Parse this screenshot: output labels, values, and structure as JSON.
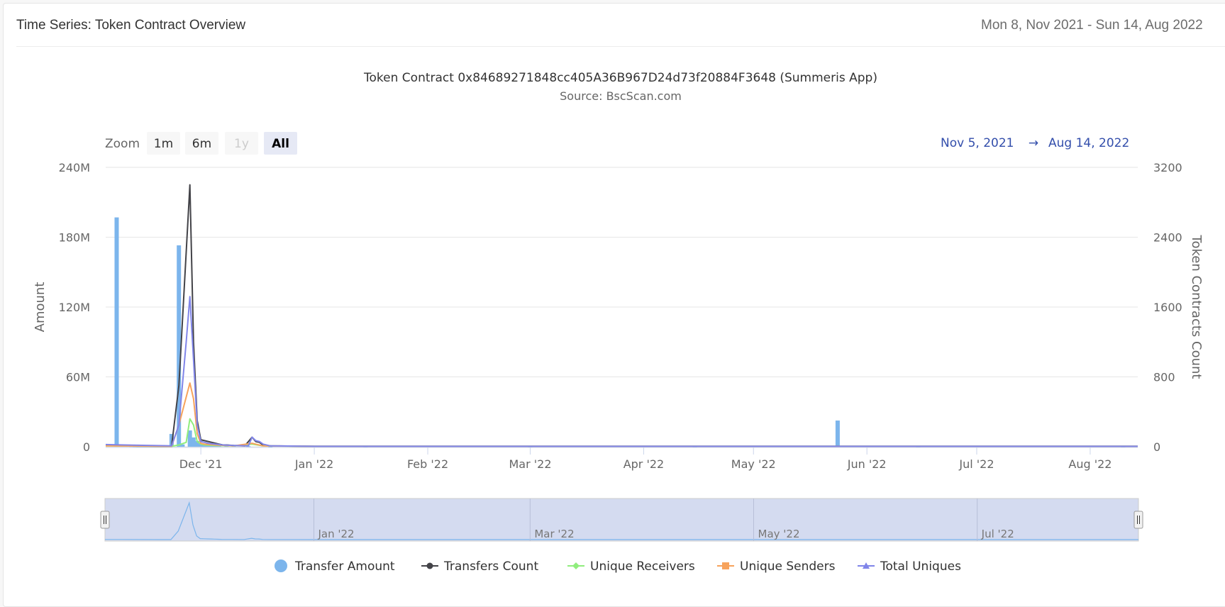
{
  "header": {
    "title": "Time Series: Token Contract Overview",
    "date_range": "Mon 8, Nov 2021 - Sun 14, Aug 2022"
  },
  "range_selector": {
    "zoom_label": "Zoom",
    "buttons": [
      {
        "label": "1m",
        "state": "normal"
      },
      {
        "label": "6m",
        "state": "normal"
      },
      {
        "label": "1y",
        "state": "disabled"
      },
      {
        "label": "All",
        "state": "active"
      }
    ],
    "from": "Nov 5, 2021",
    "arrow": "→",
    "to": "Aug 14, 2022"
  },
  "colors": {
    "transfer_amount": "#7cb5ec",
    "transfers_count": "#434348",
    "unique_receivers": "#90ed7d",
    "unique_senders": "#f7a35c",
    "total_uniques": "#8085e9",
    "navigator_mask": "#cfd7ee"
  },
  "chart_data": {
    "type": "line",
    "title": "Token Contract 0x84689271848cc405A36B967D24d73f20884F3648 (Summeris App)",
    "subtitle": "Source: BscScan.com",
    "x_type": "date",
    "x_range": [
      "2021-11-05",
      "2022-08-14"
    ],
    "x_ticks": [
      {
        "date": "2021-12-01",
        "label": "Dec '21"
      },
      {
        "date": "2022-01-01",
        "label": "Jan '22"
      },
      {
        "date": "2022-02-01",
        "label": "Feb '22"
      },
      {
        "date": "2022-03-01",
        "label": "Mar '22"
      },
      {
        "date": "2022-04-01",
        "label": "Apr '22"
      },
      {
        "date": "2022-05-01",
        "label": "May '22"
      },
      {
        "date": "2022-06-01",
        "label": "Jun '22"
      },
      {
        "date": "2022-07-01",
        "label": "Jul '22"
      },
      {
        "date": "2022-08-01",
        "label": "Aug '22"
      }
    ],
    "y_left": {
      "label": "Amount",
      "range": [
        0,
        240000000
      ],
      "ticks": [
        0,
        60000000,
        120000000,
        180000000,
        240000000
      ],
      "tick_labels": [
        "0",
        "60M",
        "120M",
        "180M",
        "240M"
      ]
    },
    "y_right": {
      "label": "Token Contracts Count",
      "range": [
        0,
        3200
      ],
      "ticks": [
        0,
        800,
        1600,
        2400,
        3200
      ],
      "tick_labels": [
        "0",
        "800",
        "1600",
        "2400",
        "3200"
      ]
    },
    "grid": true,
    "legend_position": "bottom",
    "series": [
      {
        "name": "Transfer Amount",
        "kind": "column",
        "axis": "left",
        "data": [
          [
            "2021-11-08",
            197000000
          ],
          [
            "2021-11-09",
            1000000
          ],
          [
            "2021-11-10",
            800000
          ],
          [
            "2021-11-11",
            600000
          ],
          [
            "2021-11-12",
            500000
          ],
          [
            "2021-11-13",
            400000
          ],
          [
            "2021-11-14",
            300000
          ],
          [
            "2021-11-15",
            300000
          ],
          [
            "2021-11-16",
            300000
          ],
          [
            "2021-11-17",
            300000
          ],
          [
            "2021-11-18",
            300000
          ],
          [
            "2021-11-19",
            300000
          ],
          [
            "2021-11-20",
            300000
          ],
          [
            "2021-11-21",
            300000
          ],
          [
            "2021-11-22",
            300000
          ],
          [
            "2021-11-23",
            11000000
          ],
          [
            "2021-11-25",
            173000000
          ],
          [
            "2021-11-26",
            2000000
          ],
          [
            "2021-11-28",
            14000000
          ],
          [
            "2021-11-29",
            8000000
          ],
          [
            "2021-11-30",
            5000000
          ],
          [
            "2021-12-01",
            3000000
          ],
          [
            "2021-12-02",
            2000000
          ],
          [
            "2021-12-03",
            2000000
          ],
          [
            "2021-12-04",
            1500000
          ],
          [
            "2021-12-05",
            1000000
          ],
          [
            "2021-12-06",
            1000000
          ],
          [
            "2021-12-08",
            800000
          ],
          [
            "2021-12-10",
            600000
          ],
          [
            "2021-12-14",
            500000
          ],
          [
            "2021-12-20",
            300000
          ],
          [
            "2022-01-15",
            200000
          ],
          [
            "2022-03-01",
            200000
          ],
          [
            "2022-04-15",
            200000
          ],
          [
            "2022-05-24",
            22500000
          ],
          [
            "2022-06-15",
            200000
          ],
          [
            "2022-08-10",
            200000
          ]
        ]
      },
      {
        "name": "Transfers Count",
        "kind": "line",
        "axis": "right",
        "marker": "circle",
        "data": [
          [
            "2021-11-05",
            20
          ],
          [
            "2021-11-10",
            15
          ],
          [
            "2021-11-20",
            5
          ],
          [
            "2021-11-23",
            5
          ],
          [
            "2021-11-25",
            700
          ],
          [
            "2021-11-28",
            3000
          ],
          [
            "2021-11-29",
            1200
          ],
          [
            "2021-11-30",
            300
          ],
          [
            "2021-12-01",
            80
          ],
          [
            "2021-12-02",
            70
          ],
          [
            "2021-12-03",
            60
          ],
          [
            "2021-12-04",
            50
          ],
          [
            "2021-12-05",
            40
          ],
          [
            "2021-12-06",
            30
          ],
          [
            "2021-12-07",
            20
          ],
          [
            "2021-12-08",
            20
          ],
          [
            "2021-12-10",
            15
          ],
          [
            "2021-12-13",
            10
          ],
          [
            "2021-12-15",
            110
          ],
          [
            "2021-12-16",
            60
          ],
          [
            "2021-12-17",
            50
          ],
          [
            "2021-12-18",
            20
          ],
          [
            "2021-12-20",
            10
          ],
          [
            "2022-01-01",
            5
          ],
          [
            "2022-08-14",
            5
          ]
        ]
      },
      {
        "name": "Unique Receivers",
        "kind": "line",
        "axis": "right",
        "marker": "diamond",
        "data": [
          [
            "2021-11-05",
            10
          ],
          [
            "2021-11-23",
            5
          ],
          [
            "2021-11-25",
            20
          ],
          [
            "2021-11-27",
            50
          ],
          [
            "2021-11-28",
            320
          ],
          [
            "2021-11-29",
            250
          ],
          [
            "2021-11-30",
            60
          ],
          [
            "2021-12-01",
            30
          ],
          [
            "2021-12-02",
            20
          ],
          [
            "2021-12-05",
            15
          ],
          [
            "2021-12-10",
            10
          ],
          [
            "2021-12-15",
            30
          ],
          [
            "2021-12-18",
            10
          ],
          [
            "2022-01-01",
            5
          ],
          [
            "2022-08-14",
            5
          ]
        ]
      },
      {
        "name": "Unique Senders",
        "kind": "line",
        "axis": "right",
        "marker": "square",
        "data": [
          [
            "2021-11-05",
            10
          ],
          [
            "2021-11-23",
            5
          ],
          [
            "2021-11-25",
            250
          ],
          [
            "2021-11-28",
            730
          ],
          [
            "2021-11-29",
            550
          ],
          [
            "2021-11-30",
            150
          ],
          [
            "2021-12-01",
            40
          ],
          [
            "2021-12-02",
            30
          ],
          [
            "2021-12-05",
            20
          ],
          [
            "2021-12-10",
            10
          ],
          [
            "2021-12-15",
            40
          ],
          [
            "2021-12-18",
            10
          ],
          [
            "2022-01-01",
            5
          ],
          [
            "2022-08-14",
            5
          ]
        ]
      },
      {
        "name": "Total Uniques",
        "kind": "line",
        "axis": "right",
        "marker": "triangle",
        "data": [
          [
            "2021-11-05",
            25
          ],
          [
            "2021-11-10",
            20
          ],
          [
            "2021-11-23",
            10
          ],
          [
            "2021-11-25",
            250
          ],
          [
            "2021-11-27",
            1200
          ],
          [
            "2021-11-28",
            1720
          ],
          [
            "2021-11-29",
            1000
          ],
          [
            "2021-11-30",
            250
          ],
          [
            "2021-12-01",
            60
          ],
          [
            "2021-12-02",
            50
          ],
          [
            "2021-12-03",
            40
          ],
          [
            "2021-12-04",
            35
          ],
          [
            "2021-12-05",
            30
          ],
          [
            "2021-12-07",
            20
          ],
          [
            "2021-12-10",
            15
          ],
          [
            "2021-12-14",
            10
          ],
          [
            "2021-12-15",
            110
          ],
          [
            "2021-12-16",
            70
          ],
          [
            "2021-12-17",
            60
          ],
          [
            "2021-12-18",
            30
          ],
          [
            "2021-12-20",
            10
          ],
          [
            "2022-01-01",
            5
          ],
          [
            "2022-08-14",
            5
          ]
        ]
      }
    ],
    "navigator": {
      "x_ticks": [
        {
          "date": "2022-01-01",
          "label": "Jan '22"
        },
        {
          "date": "2022-03-01",
          "label": "Mar '22"
        },
        {
          "date": "2022-05-01",
          "label": "May '22"
        },
        {
          "date": "2022-07-01",
          "label": "Jul '22"
        }
      ]
    }
  }
}
